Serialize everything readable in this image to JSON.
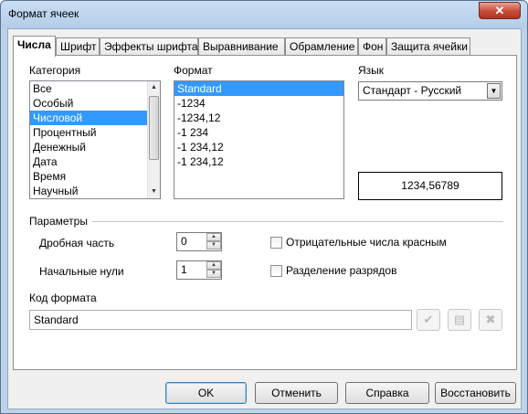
{
  "window": {
    "title": "Формат ячеек",
    "close_label": "✕"
  },
  "tabs": [
    {
      "label": "Числа",
      "active": true
    },
    {
      "label": "Шрифт"
    },
    {
      "label": "Эффекты шрифта"
    },
    {
      "label": "Выравнивание"
    },
    {
      "label": "Обрамление"
    },
    {
      "label": "Фон"
    },
    {
      "label": "Защита ячейки"
    }
  ],
  "category": {
    "label": "Категория",
    "items": [
      "Все",
      "Особый",
      "Числовой",
      "Процентный",
      "Денежный",
      "Дата",
      "Время",
      "Научный"
    ],
    "selected_index": 2
  },
  "format": {
    "label": "Формат",
    "items": [
      "Standard",
      "-1234",
      "-1234,12",
      "-1 234",
      "-1 234,12",
      "-1 234,12"
    ],
    "selected_index": 0
  },
  "language": {
    "label": "Язык",
    "value": "Стандарт - Русский"
  },
  "preview": {
    "value": "1234,56789"
  },
  "options": {
    "title": "Параметры",
    "decimal_label": "Дробная часть",
    "decimal_value": "0",
    "leading_zeros_label": "Начальные нули",
    "leading_zeros_value": "1",
    "negative_red_label": "Отрицательные числа красным",
    "negative_red_checked": false,
    "thousands_sep_label": "Разделение разрядов",
    "thousands_sep_checked": false
  },
  "format_code": {
    "label": "Код формата",
    "value": "Standard"
  },
  "buttons": {
    "ok": "OK",
    "cancel": "Отменить",
    "help": "Справка",
    "reset": "Восстановить"
  },
  "colors": {
    "selection": "#3399ff",
    "window_frame": "#bcd3ea"
  }
}
